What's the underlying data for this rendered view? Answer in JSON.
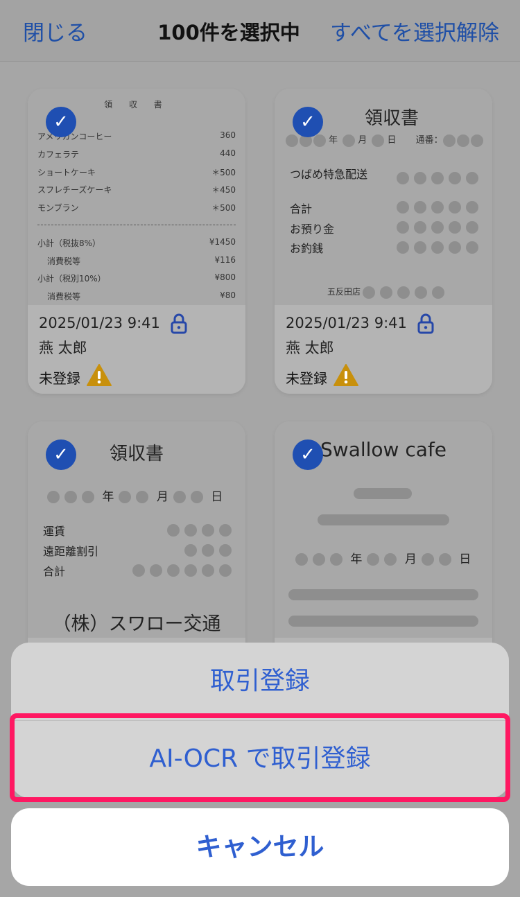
{
  "header": {
    "close_label": "閉じる",
    "title": "100件を選択中",
    "deselect_label": "すべてを選択解除"
  },
  "cards": [
    {
      "receipt": {
        "title": "領 収 書",
        "items": [
          {
            "name": "アメリカンコーヒー",
            "price": "360"
          },
          {
            "name": "カフェラテ",
            "price": "440"
          },
          {
            "name": "ショートケーキ",
            "price": "＊500"
          },
          {
            "name": "スフレチーズケーキ",
            "price": "＊450"
          },
          {
            "name": "モンブラン",
            "price": "＊500"
          }
        ],
        "totals": [
          {
            "name": "小計（税抜8%）",
            "price": "¥1450"
          },
          {
            "name": "消費税等",
            "price": "¥116"
          },
          {
            "name": "小計（税別10%）",
            "price": "¥800"
          },
          {
            "name": "消費税等",
            "price": "¥80"
          }
        ]
      },
      "datetime": "2025/01/23 9:41",
      "owner": "燕 太郎",
      "status": "未登録"
    },
    {
      "receipt": {
        "title": "領収書",
        "date_labels": [
          "年",
          "月",
          "日"
        ],
        "serial_label": "通番：",
        "item": "つばめ特急配送",
        "rows": [
          "合計",
          "お預り金",
          "お釣銭"
        ],
        "store": "五反田店"
      },
      "datetime": "2025/01/23 9:41",
      "owner": "燕 太郎",
      "status": "未登録"
    },
    {
      "receipt": {
        "title": "領収書",
        "date_labels": [
          "年",
          "月",
          "日"
        ],
        "rows": [
          "運賃",
          "遠距離割引",
          "合計"
        ],
        "company": "（株）スワロー交通"
      }
    },
    {
      "receipt": {
        "title": "Swallow cafe",
        "date_labels": [
          "年",
          "月",
          "日"
        ]
      }
    }
  ],
  "action_sheet": {
    "register_label": "取引登録",
    "ai_ocr_label": "AI-OCR で取引登録",
    "cancel_label": "キャンセル"
  },
  "colors": {
    "accent": "#2f5fd0",
    "highlight": "#ff1862",
    "check": "#1f4fb2",
    "warning": "#c8900c"
  }
}
